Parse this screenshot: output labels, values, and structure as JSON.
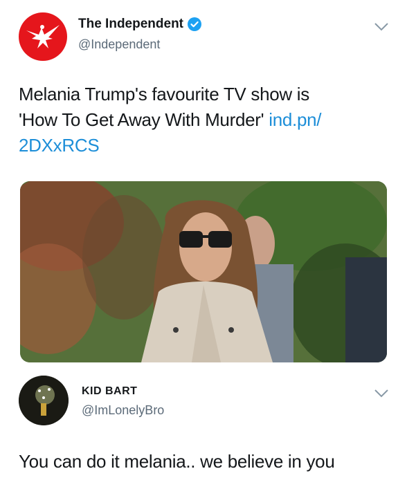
{
  "tweet1": {
    "display_name": "The Independent",
    "handle": "@Independent",
    "verified": true,
    "text_line1": "Melania Trump's favourite TV show is",
    "text_line2": "'How To Get Away With Murder'",
    "link_part1": "ind.pn/",
    "link_part2": "2DXxRCS",
    "avatar_icon": "eagle-icon",
    "avatar_color": "#e5161c"
  },
  "tweet2": {
    "display_name": "KID BART",
    "handle": "@ImLonelyBro",
    "text": "You can do it melania.. we believe in you"
  },
  "colors": {
    "link": "#1d8ed8",
    "handle": "#5b6a78",
    "verified": "#1da1f2"
  }
}
